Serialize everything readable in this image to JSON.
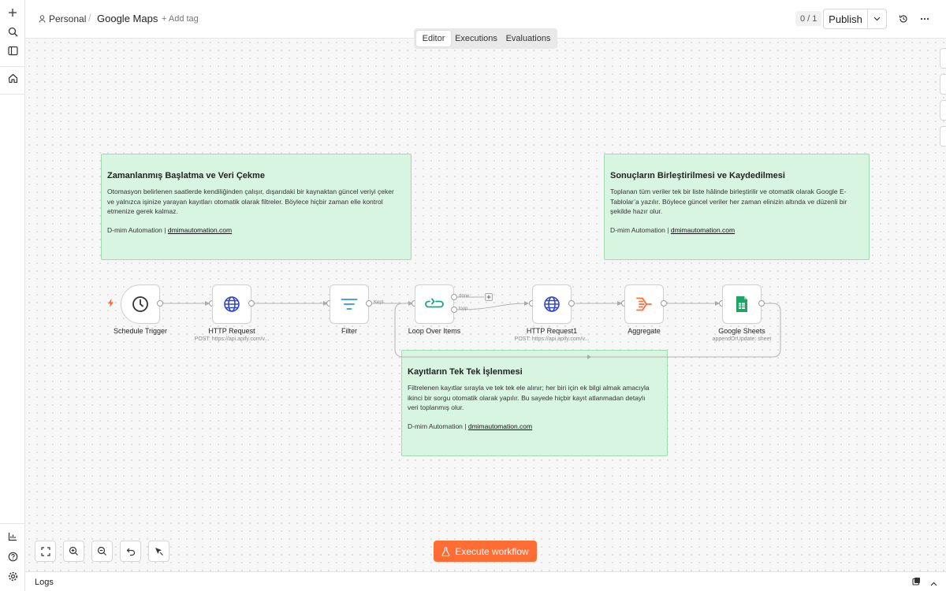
{
  "breadcrumb": {
    "project": "Personal",
    "separator": "/",
    "workflow": "Google Maps",
    "add_tag": "+ Add tag"
  },
  "header": {
    "version_counter": "0 / 1",
    "publish_label": "Publish"
  },
  "tabs": [
    {
      "label": "Editor",
      "active": true
    },
    {
      "label": "Executions",
      "active": false
    },
    {
      "label": "Evaluations",
      "active": false
    }
  ],
  "sticky_notes": [
    {
      "title": "Zamanlanmış Başlatma ve Veri Çekme",
      "lines": [
        "Otomasyon belirlenen saatlerde kendiliğinden çalışır, dışarıdaki bir kaynaktan güncel veriyi çeker",
        "ve yalnızca işinize yarayan kayıtları otomatik olarak filtreler. Böylece hiçbir zaman elle kontrol",
        "etmenize gerek kalmaz."
      ],
      "signature_prefix": "D-mim Automation |",
      "signature_link": "dmimautomation.com"
    },
    {
      "title": "Sonuçların Birleştirilmesi ve Kaydedilmesi",
      "lines": [
        "Toplanan tüm veriler tek bir liste hâlinde birleştirilir ve otomatik olarak Google E-",
        "Tablolar’a yazılır. Böylece güncel veriler her zaman elinizin altında ve düzenli bir",
        "şekilde hazır olur."
      ],
      "signature_prefix": "D-mim Automation |",
      "signature_link": "dmimautomation.com"
    },
    {
      "title": "Kayıtların Tek Tek İşlenmesi",
      "lines": [
        "Filtrelenen kayıtlar sırayla ve tek tek ele alınır; her biri için ek bilgi almak amacıyla",
        "ikinci bir sorgu otomatik olarak yapılır. Bu sayede hiçbir kayıt atlanmadan detaylı",
        "veri toplanmış olur."
      ],
      "signature_prefix": "D-mim Automation |",
      "signature_link": "dmimautomation.com"
    }
  ],
  "nodes": [
    {
      "label": "Schedule Trigger",
      "subtitle": "",
      "icon": "clock-icon"
    },
    {
      "label": "HTTP Request",
      "subtitle": "POST: https://api.apify.com/v...",
      "icon": "globe-icon"
    },
    {
      "label": "Filter",
      "subtitle": "",
      "icon": "filter-icon"
    },
    {
      "label": "Loop Over Items",
      "subtitle": "",
      "icon": "loop-icon"
    },
    {
      "label": "HTTP Request1",
      "subtitle": "POST: https://api.apify.com/v...",
      "icon": "globe-icon"
    },
    {
      "label": "Aggregate",
      "subtitle": "",
      "icon": "aggregate-icon"
    },
    {
      "label": "Google Sheets",
      "subtitle": "appendOrUpdate: sheet",
      "icon": "google-sheets-icon"
    }
  ],
  "edge_labels": {
    "kept": "Kept",
    "done": "done",
    "loop": "loop"
  },
  "execute_label": "Execute workflow",
  "logs_label": "Logs",
  "colors": {
    "accent": "#ff6d35",
    "sticky_bg": "#d8f5e1",
    "sticky_border": "#9fdcb2",
    "globe": "#3347c9",
    "filter": "#4aa3df",
    "loop": "#1aa58a",
    "aggregate": "#ff6d35",
    "sheets": "#1fa463"
  }
}
